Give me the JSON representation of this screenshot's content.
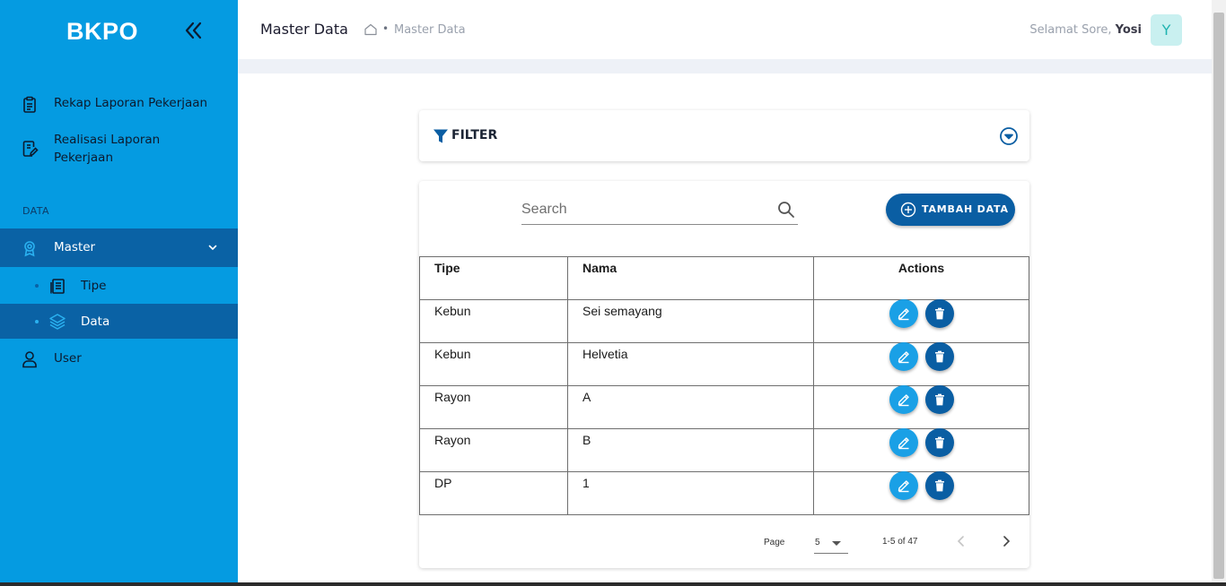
{
  "app": {
    "brand": "BKPO"
  },
  "sidebar": {
    "items": [
      {
        "label": "Rekap Laporan Pekerjaan",
        "icon": "clipboard-icon"
      },
      {
        "label": "Realisasi Laporan Pekerjaan",
        "icon": "document-edit-icon"
      }
    ],
    "section_label": "DATA",
    "master": {
      "label": "Master",
      "icon": "award-icon"
    },
    "sub_items": [
      {
        "label": "Tipe",
        "icon": "copy-icon"
      },
      {
        "label": "Data",
        "icon": "layers-icon"
      }
    ],
    "user": {
      "label": "User",
      "icon": "user-icon"
    }
  },
  "header": {
    "title": "Master Data",
    "breadcrumb_current": "Master Data",
    "greeting_prefix": "Selamat Sore,",
    "user_name": "Yosi",
    "avatar_initial": "Y"
  },
  "filter": {
    "label": "FILTER"
  },
  "search": {
    "placeholder": "Search",
    "value": ""
  },
  "add_button": {
    "label": "TAMBAH DATA"
  },
  "table": {
    "headers": [
      "Tipe",
      "Nama",
      "Actions"
    ],
    "rows": [
      {
        "tipe": "Kebun",
        "nama": "Sei semayang"
      },
      {
        "tipe": "Kebun",
        "nama": "Helvetia"
      },
      {
        "tipe": "Rayon",
        "nama": "A"
      },
      {
        "tipe": "Rayon",
        "nama": "B"
      },
      {
        "tipe": "DP",
        "nama": "1"
      }
    ]
  },
  "pagination": {
    "page_label": "Page",
    "page_size": "5",
    "range": "1-5 of 47"
  },
  "colors": {
    "sidebar_bg": "#059be1",
    "sidebar_active": "#0a62a5",
    "primary_button": "#0a5ea3",
    "edit_button": "#1aa0e6",
    "avatar_bg": "#c9f0f0"
  }
}
